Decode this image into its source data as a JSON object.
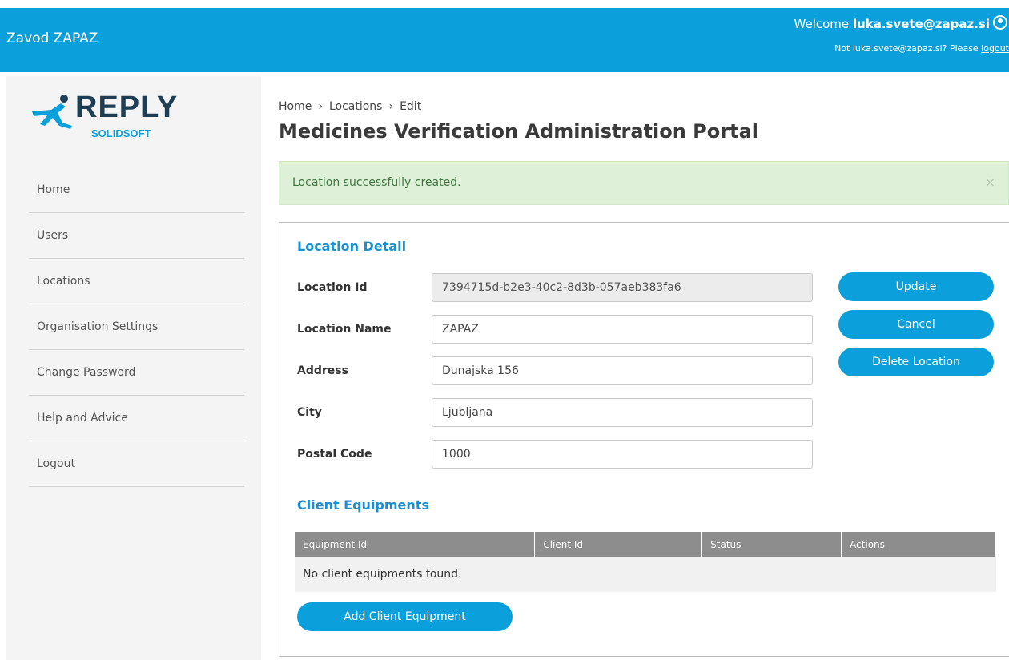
{
  "header": {
    "org_name": "Zavod ZAPAZ",
    "welcome_prefix": "Welcome",
    "user_email": "luka.svete@zapaz.si",
    "not_user_text": "Not luka.svete@zapaz.si? Please",
    "logout_link": "logout"
  },
  "logo": {
    "word": "REPLY",
    "sub": "SOLIDSOFT"
  },
  "sidebar": {
    "items": [
      {
        "label": "Home"
      },
      {
        "label": "Users"
      },
      {
        "label": "Locations"
      },
      {
        "label": "Organisation Settings"
      },
      {
        "label": "Change Password"
      },
      {
        "label": "Help and Advice"
      },
      {
        "label": "Logout"
      }
    ]
  },
  "breadcrumb": {
    "items": [
      "Home",
      "Locations",
      "Edit"
    ],
    "separator": "›"
  },
  "page_title": "Medicines Verification Administration Portal",
  "alert": {
    "message": "Location successfully created.",
    "close": "×"
  },
  "location_detail": {
    "title": "Location Detail",
    "fields": {
      "location_id": {
        "label": "Location Id",
        "value": "7394715d-b2e3-40c2-8d3b-057aeb383fa6"
      },
      "location_name": {
        "label": "Location Name",
        "value": "ZAPAZ"
      },
      "address": {
        "label": "Address",
        "value": "Dunajska 156"
      },
      "city": {
        "label": "City",
        "value": "Ljubljana"
      },
      "postal_code": {
        "label": "Postal Code",
        "value": "1000"
      }
    },
    "buttons": {
      "update": "Update",
      "cancel": "Cancel",
      "delete": "Delete Location"
    }
  },
  "client_equipments": {
    "title": "Client Equipments",
    "columns": [
      "Equipment Id",
      "Client Id",
      "Status",
      "Actions"
    ],
    "empty_message": "No client equipments found.",
    "add_button": "Add Client Equipment"
  },
  "colors": {
    "brand": "#0ba0dc",
    "logo_dark": "#1d3e54",
    "alert_bg": "#dff0d8",
    "alert_text": "#3c763d",
    "table_header": "#8d8d8d"
  }
}
